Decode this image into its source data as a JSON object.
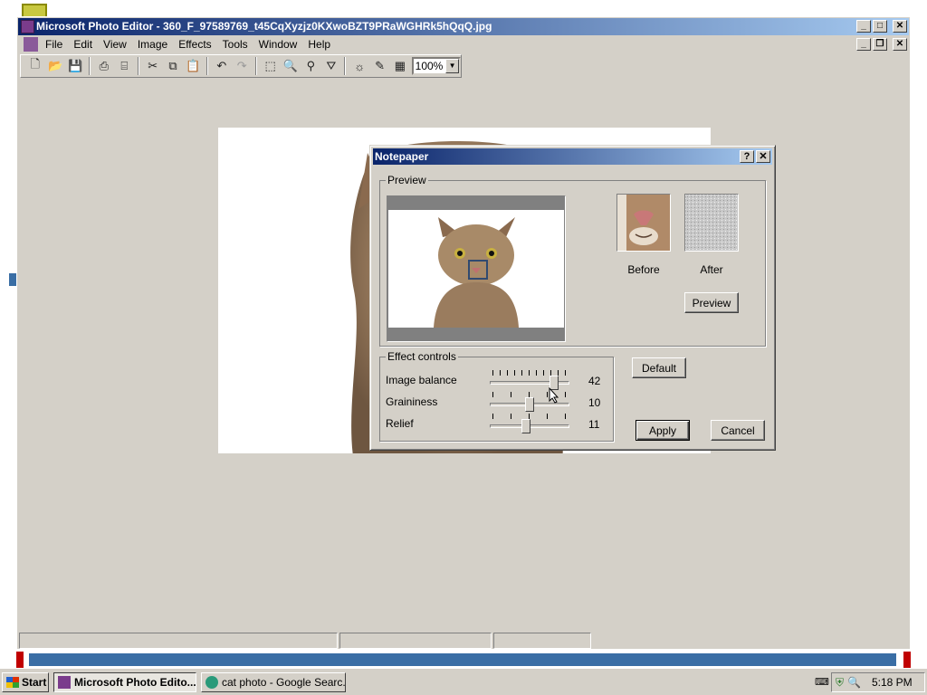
{
  "window": {
    "title": "Microsoft Photo Editor - 360_F_97589769_t45CqXyzjz0KXwoBZT9PRaWGHRk5hQqQ.jpg",
    "controls": [
      "_",
      "□",
      "✕"
    ]
  },
  "menu": {
    "items": [
      "File",
      "Edit",
      "View",
      "Image",
      "Effects",
      "Tools",
      "Window",
      "Help"
    ]
  },
  "toolbar": {
    "zoom_value": "100%"
  },
  "dialog": {
    "title": "Notepaper",
    "help_label": "?",
    "close_label": "✕",
    "preview_group": "Preview",
    "before_label": "Before",
    "after_label": "After",
    "preview_button": "Preview",
    "effect_group": "Effect controls",
    "default_button": "Default",
    "apply_button": "Apply",
    "cancel_button": "Cancel",
    "controls": [
      {
        "label": "Image balance",
        "value": "42",
        "level": 0.84
      },
      {
        "label": "Graininess",
        "value": "10",
        "level": 0.5
      },
      {
        "label": "Relief",
        "value": "11",
        "level": 0.45
      }
    ]
  },
  "taskbar": {
    "start_label": "Start",
    "tasks": [
      {
        "label": "Microsoft Photo Edito...",
        "active": true
      },
      {
        "label": "cat photo - Google Searc...",
        "active": false
      }
    ],
    "clock": "5:18 PM"
  },
  "colors": {
    "title_active": "#0a246a",
    "face": "#d4d0c8",
    "desktop_bar": "#3a6ea5"
  }
}
